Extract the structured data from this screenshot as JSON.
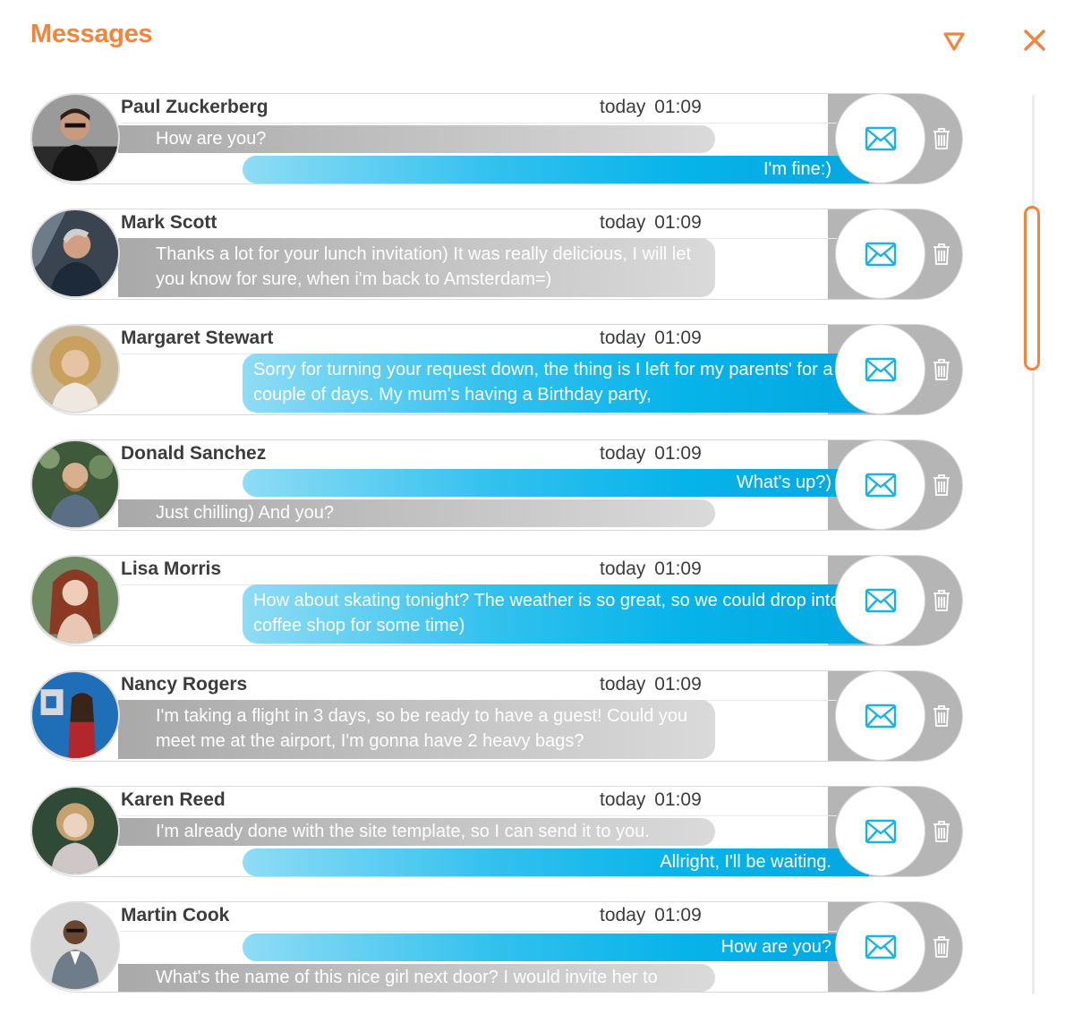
{
  "header": {
    "title": "Messages",
    "filter_icon": "filter-triangle-icon",
    "close_icon": "close-icon"
  },
  "colors": {
    "accent": "#f5843b",
    "incoming_bubble": "#b5b5b5",
    "outgoing_bubble": "#05b2e8",
    "mail_icon": "#1ab3e6"
  },
  "conversations": [
    {
      "name": "Paul Zuckerberg",
      "date": "today",
      "time": "01:09",
      "messages": [
        {
          "direction": "incoming",
          "text": "How are you?"
        },
        {
          "direction": "outgoing",
          "text": "I'm fine:)"
        }
      ]
    },
    {
      "name": "Mark Scott",
      "date": "today",
      "time": "01:09",
      "messages": [
        {
          "direction": "incoming",
          "text": "Thanks a lot for your lunch invitation) It was really delicious, I will let you know for sure, when i'm back to Amsterdam=)"
        }
      ]
    },
    {
      "name": "Margaret Stewart",
      "date": "today",
      "time": "01:09",
      "messages": [
        {
          "direction": "outgoing",
          "text": "Sorry for turning your request down, the thing is I left for my parents' for a couple of days. My mum's having a Birthday party,"
        }
      ]
    },
    {
      "name": "Donald Sanchez",
      "date": "today",
      "time": "01:09",
      "messages": [
        {
          "direction": "outgoing",
          "text": "What's up?)"
        },
        {
          "direction": "incoming",
          "text": "Just chilling) And you?"
        }
      ]
    },
    {
      "name": "Lisa Morris",
      "date": "today",
      "time": "01:09",
      "messages": [
        {
          "direction": "outgoing",
          "text": "How about skating tonight? The weather is so great, so we could drop into a coffee shop for some time)"
        }
      ]
    },
    {
      "name": "Nancy Rogers",
      "date": "today",
      "time": "01:09",
      "messages": [
        {
          "direction": "incoming",
          "text": "I'm taking a flight in 3 days, so be ready to have a guest! Could you meet me at the airport, I'm gonna have 2 heavy bags?"
        }
      ]
    },
    {
      "name": "Karen Reed",
      "date": "today",
      "time": "01:09",
      "messages": [
        {
          "direction": "incoming",
          "text": "I'm already done with the site template, so I can send it to you."
        },
        {
          "direction": "outgoing",
          "text": "Allright, I'll be waiting."
        }
      ]
    },
    {
      "name": "Martin Cook",
      "date": "today",
      "time": "01:09",
      "messages": [
        {
          "direction": "outgoing",
          "text": "How are you?"
        },
        {
          "direction": "incoming",
          "text": "What's the name of this nice girl next door? I would invite her to"
        }
      ]
    }
  ]
}
